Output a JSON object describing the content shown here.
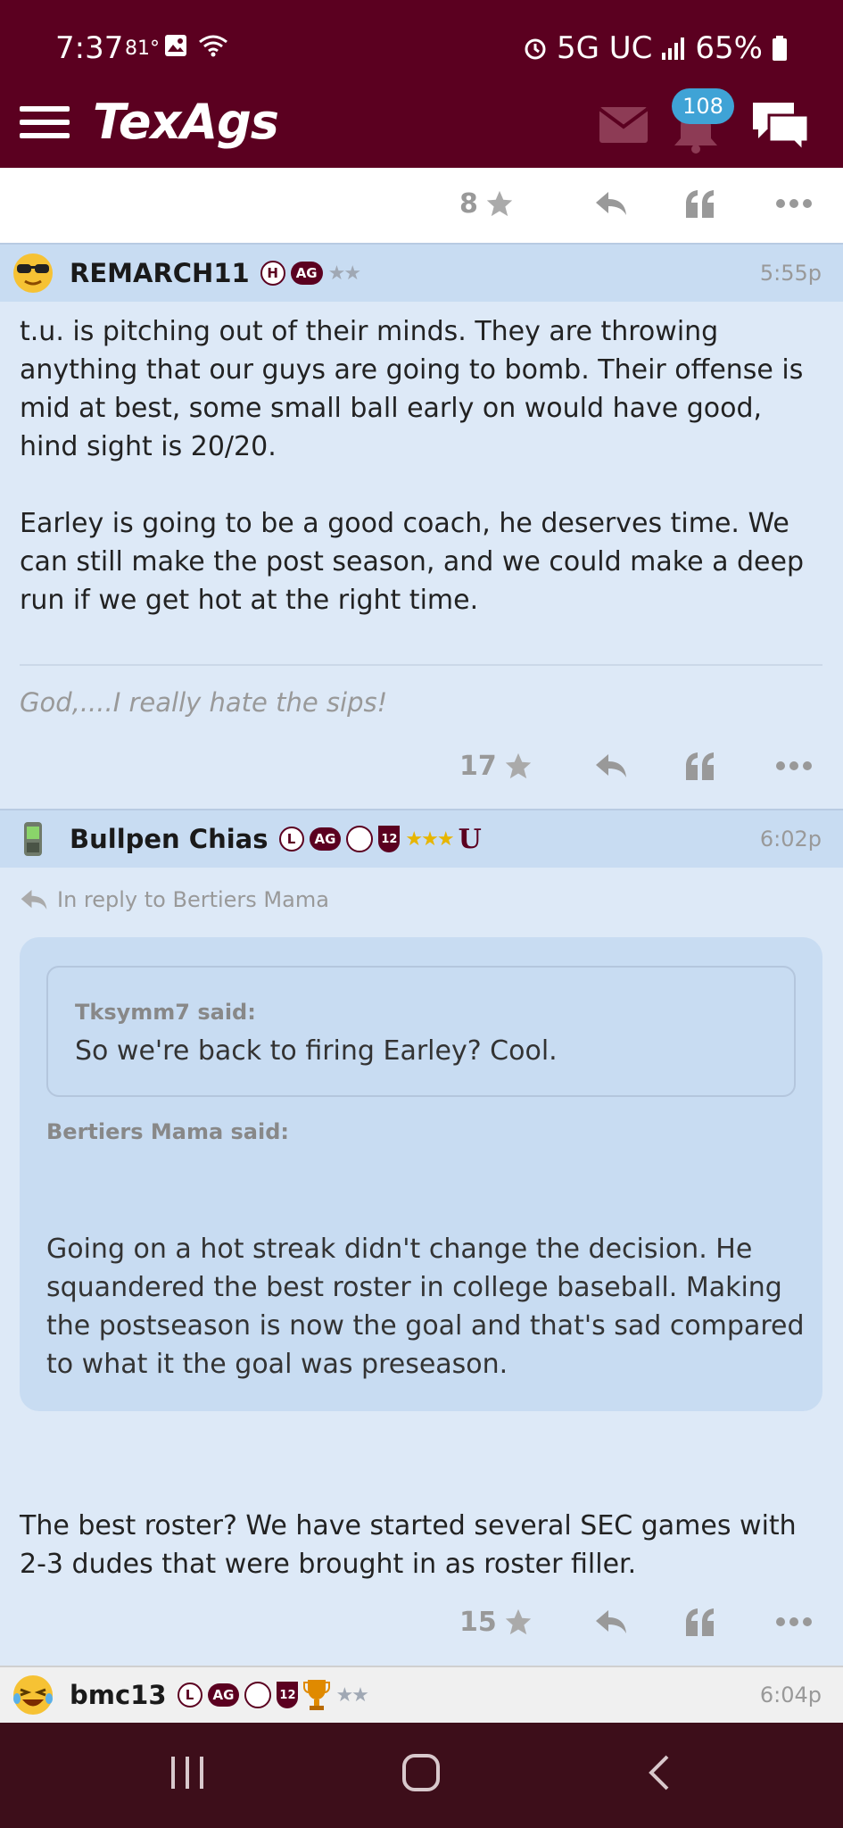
{
  "status": {
    "time": "7:37",
    "temp": "81°",
    "network": "5G UC",
    "battery": "65%"
  },
  "app": {
    "logo": "TexAgs",
    "notif_count": "108"
  },
  "prev_post": {
    "rating": "8"
  },
  "posts": [
    {
      "username": "REMARCH11",
      "badges": [
        "H",
        "AG"
      ],
      "time": "5:55p",
      "body": [
        "t.u. is pitching out of their minds. They are throwing anything that our guys are going to bomb. Their offense is mid at best, some small ball early on would have good, hind sight is 20/20.",
        "Earley is going to be a good coach, he deserves time. We can still make the post season, and we could make a deep run if we get hot at the right time."
      ],
      "signature": "God,....I really hate the sips!",
      "rating": "17"
    },
    {
      "username": "Bullpen Chias",
      "badges": [
        "L",
        "AG",
        "12"
      ],
      "extra_badge": "U",
      "time": "6:02p",
      "in_reply_to": "In reply to Bertiers Mama",
      "quote_inner_said": "Tksymm7 said:",
      "quote_inner_text": "So we're back to firing Earley? Cool.",
      "quote_outer_said": "Bertiers Mama said:",
      "quote_outer_text": "Going on a hot streak didn't change the decision. He squandered the best roster in college baseball. Making the postseason is now the goal and that's sad compared to what it the goal was preseason.",
      "body": "The best roster? We have started several SEC games with 2-3 dudes that were brought in as roster filler.",
      "rating": "15"
    },
    {
      "username": "bmc13",
      "badges": [
        "L",
        "AG",
        "12"
      ],
      "time": "6:04p"
    }
  ]
}
